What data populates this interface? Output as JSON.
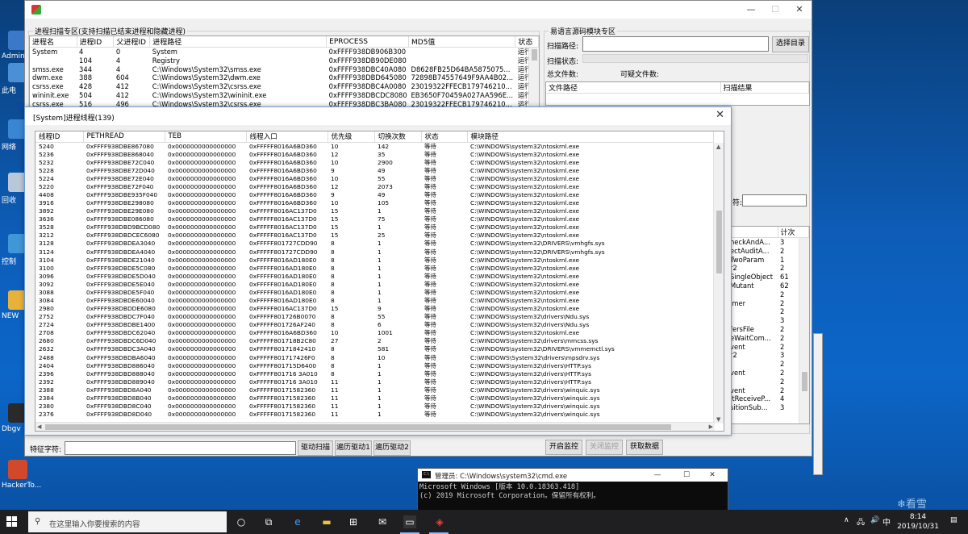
{
  "desktop": {
    "icons": [
      {
        "label": "Admin",
        "color": "#3a78c9"
      },
      {
        "label": "此电",
        "color": "#4b8fd6"
      },
      {
        "label": "网络",
        "color": "#3b86d2"
      },
      {
        "label": "回收",
        "color": "#b9c8d8"
      },
      {
        "label": "控制",
        "color": "#3f97d8"
      },
      {
        "label": "NEW",
        "color": "#e8b13a"
      },
      {
        "label": "Dbgv",
        "color": "#2a2a2a"
      },
      {
        "label": "HackerTo...",
        "color": "#d2482b"
      }
    ]
  },
  "main_window": {
    "minimize": "—",
    "maximize": "☐",
    "close": "✕",
    "process_group_title": "进程扫描专区(支持扫描已结束进程和隐藏进程)",
    "process_columns": [
      "进程名",
      "进程ID",
      "父进程ID",
      "进程路径",
      "EPROCESS",
      "MD5值",
      "状态"
    ],
    "process_rows": [
      [
        "System",
        "4",
        "0",
        "System",
        "0xFFFF938DB906B300",
        "",
        "运行"
      ],
      [
        "",
        "104",
        "4",
        "Registry",
        "0xFFFF938DB90DE080",
        "",
        "运行"
      ],
      [
        "smss.exe",
        "344",
        "4",
        "C:\\Windows\\System32\\smss.exe",
        "0xFFFF938DBC40A080",
        "D8628FB25D64BA5875075...",
        "运行"
      ],
      [
        "dwm.exe",
        "388",
        "604",
        "C:\\Windows\\System32\\dwm.exe",
        "0xFFFF938DBD645080",
        "72898B74557649F9AA4B02...",
        "运行"
      ],
      [
        "csrss.exe",
        "428",
        "412",
        "C:\\Windows\\System32\\csrss.exe",
        "0xFFFF938DBC4A0080",
        "23019322FFECB179746210...",
        "运行"
      ],
      [
        "wininit.exe",
        "504",
        "412",
        "C:\\Windows\\System32\\wininit.exe",
        "0xFFFF938DBCDC8080",
        "EB3650F70459A027AA596E...",
        "运行"
      ],
      [
        "csrss.exe",
        "516",
        "496",
        "C:\\Windows\\System32\\csrss.exe",
        "0xFFFF938DBC3BA080",
        "23019322FFECB179746210...",
        "运行"
      ]
    ],
    "feature_label": "特征字符:",
    "feature_input_value": "",
    "btn_driver_scan": "驱动扫描",
    "btn_traverse1": "遍历驱动1",
    "btn_traverse2": "遍历驱动2",
    "yy_group_title": "易语言源码模块专区",
    "scan_path_label": "扫描路径:",
    "scan_path_value": "",
    "btn_select_dir": "选择目录",
    "scan_status_label": "扫描状态:",
    "total_files_label": "总文件数:",
    "suspicious_files_label": "可疑文件数:",
    "file_columns": [
      "文件路径",
      "扫描结果"
    ],
    "side_label_fragment": "符:",
    "side_list_header": "计次",
    "side_list_rows": [
      [
        "heckAndA...",
        "3"
      ],
      [
        "ectAuditA...",
        "2"
      ],
      [
        "TwoParam",
        "1"
      ],
      [
        "r2",
        "2"
      ],
      [
        "SingleObject",
        "61"
      ],
      [
        "Mutant",
        "62"
      ],
      [
        "",
        "2"
      ],
      [
        "imer",
        "2"
      ],
      [
        "",
        "2"
      ],
      [
        "",
        "3"
      ],
      [
        "fersFile",
        "2"
      ],
      [
        "eWaitCom...",
        "2"
      ],
      [
        "vent",
        "2"
      ],
      [
        "r2",
        "3"
      ],
      [
        "",
        "2"
      ],
      [
        "vent",
        "2"
      ],
      [
        "",
        "2"
      ],
      [
        "vent",
        "2"
      ],
      [
        "itReceiveP...",
        "4"
      ],
      [
        "sitionSub...",
        "3"
      ]
    ],
    "btn_start_monitor": "开启监控",
    "btn_stop_monitor": "关闭监控",
    "btn_get_data": "获取数据"
  },
  "thread_dialog": {
    "title": "[System]进程线程(139)",
    "close": "✕",
    "columns": [
      "线程ID",
      "PETHREAD",
      "TEB",
      "线程入口",
      "优先级",
      "切换次数",
      "状态",
      "模块路径"
    ],
    "rows": [
      [
        "5240",
        "0xFFFF938DBE867080",
        "0x0000000000000000",
        "0xFFFFF8016A6BD360",
        "10",
        "142",
        "等待",
        "C:\\WINDOWS\\system32\\ntoskrnl.exe"
      ],
      [
        "5236",
        "0xFFFF938DBE868040",
        "0x0000000000000000",
        "0xFFFFF8016A6BD360",
        "12",
        "35",
        "等待",
        "C:\\WINDOWS\\system32\\ntoskrnl.exe"
      ],
      [
        "5232",
        "0xFFFF938DBE72C040",
        "0x0000000000000000",
        "0xFFFFF8016A6BD360",
        "10",
        "2900",
        "等待",
        "C:\\WINDOWS\\system32\\ntoskrnl.exe"
      ],
      [
        "5228",
        "0xFFFF938DBE72D040",
        "0x0000000000000000",
        "0xFFFFF8016A6BD360",
        "9",
        "49",
        "等待",
        "C:\\WINDOWS\\system32\\ntoskrnl.exe"
      ],
      [
        "5224",
        "0xFFFF938DBE72E040",
        "0x0000000000000000",
        "0xFFFFF8016A6BD360",
        "10",
        "55",
        "等待",
        "C:\\WINDOWS\\system32\\ntoskrnl.exe"
      ],
      [
        "5220",
        "0xFFFF938DBE72F040",
        "0x0000000000000000",
        "0xFFFFF8016A6BD360",
        "12",
        "2073",
        "等待",
        "C:\\WINDOWS\\system32\\ntoskrnl.exe"
      ],
      [
        "4408",
        "0xFFFF938DBE935F040",
        "0x0000000000000000",
        "0xFFFFF8016A6BD360",
        "9",
        "49",
        "等待",
        "C:\\WINDOWS\\system32\\ntoskrnl.exe"
      ],
      [
        "3916",
        "0xFFFF938DBE298080",
        "0x0000000000000000",
        "0xFFFFF8016A6BD360",
        "10",
        "105",
        "等待",
        "C:\\WINDOWS\\system32\\ntoskrnl.exe"
      ],
      [
        "3892",
        "0xFFFF938DBE29E080",
        "0x0000000000000000",
        "0xFFFFF8016AC137D0",
        "15",
        "1",
        "等待",
        "C:\\WINDOWS\\system32\\ntoskrnl.exe"
      ],
      [
        "3636",
        "0xFFFF938DBE086080",
        "0x0000000000000000",
        "0xFFFFF8016AC137D0",
        "15",
        "75",
        "等待",
        "C:\\WINDOWS\\system32\\ntoskrnl.exe"
      ],
      [
        "3528",
        "0xFFFF938DBD9BCD080",
        "0x0000000000000000",
        "0xFFFFF8016AC137D0",
        "15",
        "1",
        "等待",
        "C:\\WINDOWS\\system32\\ntoskrnl.exe"
      ],
      [
        "3212",
        "0xFFFF938DBDCEC6080",
        "0x0000000000000000",
        "0xFFFFF8016AC137D0",
        "15",
        "25",
        "等待",
        "C:\\WINDOWS\\system32\\ntoskrnl.exe"
      ],
      [
        "3128",
        "0xFFFF938DBDEA3040",
        "0x0000000000000000",
        "0xFFFFF801727CDD90",
        "8",
        "1",
        "等待",
        "C:\\WINDOWS\\system32\\DRIVERS\\vmhgfs.sys"
      ],
      [
        "3124",
        "0xFFFF938DBDEA4040",
        "0x0000000000000000",
        "0xFFFFF801727CDD90",
        "8",
        "1",
        "等待",
        "C:\\WINDOWS\\system32\\DRIVERS\\vmhgfs.sys"
      ],
      [
        "3104",
        "0xFFFF938DBDE21040",
        "0x0000000000000000",
        "0xFFFFF8016AD180E0",
        "8",
        "1",
        "等待",
        "C:\\WINDOWS\\system32\\ntoskrnl.exe"
      ],
      [
        "3100",
        "0xFFFF938DBDE5C080",
        "0x0000000000000000",
        "0xFFFFF8016AD180E0",
        "8",
        "1",
        "等待",
        "C:\\WINDOWS\\system32\\ntoskrnl.exe"
      ],
      [
        "3096",
        "0xFFFF938DBDE5D040",
        "0x0000000000000000",
        "0xFFFFF8016AD180E0",
        "8",
        "1",
        "等待",
        "C:\\WINDOWS\\system32\\ntoskrnl.exe"
      ],
      [
        "3092",
        "0xFFFF938DBDE5E040",
        "0x0000000000000000",
        "0xFFFFF8016AD180E0",
        "8",
        "1",
        "等待",
        "C:\\WINDOWS\\system32\\ntoskrnl.exe"
      ],
      [
        "3088",
        "0xFFFF938DBDE5F040",
        "0x0000000000000000",
        "0xFFFFF8016AD180E0",
        "8",
        "1",
        "等待",
        "C:\\WINDOWS\\system32\\ntoskrnl.exe"
      ],
      [
        "3084",
        "0xFFFF938DBDE60040",
        "0x0000000000000000",
        "0xFFFFF8016AD180E0",
        "8",
        "1",
        "等待",
        "C:\\WINDOWS\\system32\\ntoskrnl.exe"
      ],
      [
        "2980",
        "0xFFFF938DBDDE6080",
        "0x0000000000000000",
        "0xFFFFF8016AC137D0",
        "15",
        "9",
        "等待",
        "C:\\WINDOWS\\system32\\ntoskrnl.exe"
      ],
      [
        "2752",
        "0xFFFF938DBDC7F040",
        "0x0000000000000000",
        "0xFFFFF801726B0070",
        "8",
        "55",
        "等待",
        "C:\\WINDOWS\\system32\\drivers\\Ndu.sys"
      ],
      [
        "2724",
        "0xFFFF938DBDBE1400",
        "0x0000000000000000",
        "0xFFFFF801726AF240",
        "8",
        "6",
        "等待",
        "C:\\WINDOWS\\system32\\drivers\\Ndu.sys"
      ],
      [
        "2708",
        "0xFFFF938DBDC62040",
        "0x0000000000000000",
        "0xFFFFF8016A6BD360",
        "10",
        "1001",
        "等待",
        "C:\\WINDOWS\\system32\\ntoskrnl.exe"
      ],
      [
        "2680",
        "0xFFFF938DBDC6D040",
        "0x0000000000000000",
        "0xFFFFF801718B2C80",
        "27",
        "2",
        "等待",
        "C:\\WINDOWS\\system32\\drivers\\mmcss.sys"
      ],
      [
        "2632",
        "0xFFFF938DBDC3A040",
        "0x0000000000000000",
        "0xFFFFF80171842410",
        "8",
        "581",
        "等待",
        "C:\\WINDOWS\\system32\\DRIVERS\\vmmemctl.sys"
      ],
      [
        "2488",
        "0xFFFF938DBDBA6040",
        "0x0000000000000000",
        "0xFFFFF801717426F0",
        "8",
        "10",
        "等待",
        "C:\\WINDOWS\\System32\\drivers\\mpsdrv.sys"
      ],
      [
        "2404",
        "0xFFFF938DBD886040",
        "0x0000000000000000",
        "0xFFFFF801715D6400",
        "8",
        "1",
        "等待",
        "C:\\WINDOWS\\system32\\drivers\\HTTP.sys"
      ],
      [
        "2396",
        "0xFFFF938DBD888040",
        "0x0000000000000000",
        "0xFFFFF801716 3A010",
        "8",
        "1",
        "等待",
        "C:\\WINDOWS\\system32\\drivers\\HTTP.sys"
      ],
      [
        "2392",
        "0xFFFF938DBD889040",
        "0x0000000000000000",
        "0xFFFFF801716 3A010",
        "11",
        "1",
        "等待",
        "C:\\WINDOWS\\system32\\drivers\\HTTP.sys"
      ],
      [
        "2388",
        "0xFFFF938DBD8A040",
        "0x0000000000000000",
        "0xFFFFF80171582360",
        "11",
        "1",
        "等待",
        "C:\\WINDOWS\\system32\\drivers\\winquic.sys"
      ],
      [
        "2384",
        "0xFFFF938DBD8B040",
        "0x0000000000000000",
        "0xFFFFF80171582360",
        "11",
        "1",
        "等待",
        "C:\\WINDOWS\\system32\\drivers\\winquic.sys"
      ],
      [
        "2380",
        "0xFFFF938DBD8C040",
        "0x0000000000000000",
        "0xFFFFF80171582360",
        "11",
        "1",
        "等待",
        "C:\\WINDOWS\\system32\\drivers\\winquic.sys"
      ],
      [
        "2376",
        "0xFFFF938DBD8D040",
        "0x0000000000000000",
        "0xFFFFF80171582360",
        "11",
        "1",
        "等待",
        "C:\\WINDOWS\\system32\\drivers\\winquic.sys"
      ]
    ]
  },
  "cmd_window": {
    "title": "管理员: C:\\Windows\\system32\\cmd.exe",
    "icon_text": "C:\\",
    "minimize": "—",
    "maximize": "☐",
    "close": "✕",
    "lines": [
      "Microsoft Windows [版本 10.0.18363.418]",
      "(c) 2019 Microsoft Corporation。保留所有权利。"
    ]
  },
  "taskbar": {
    "search_placeholder": "在这里输入你要搜索的内容",
    "tray_arrow": "∧",
    "tray_ime": "中",
    "time": "8:14",
    "date": "2019/10/31",
    "notification": "▤"
  },
  "watermark": "❄看雪"
}
